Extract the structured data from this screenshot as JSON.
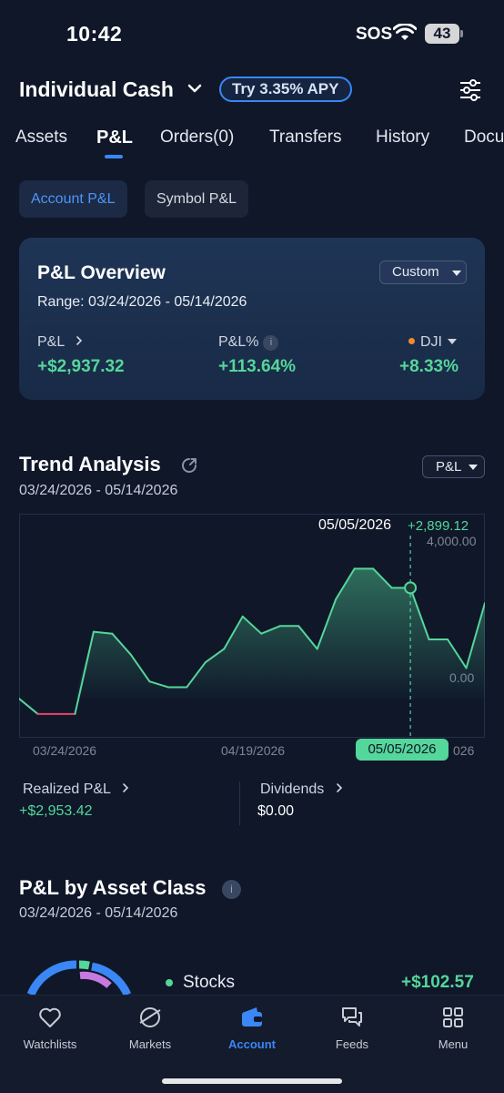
{
  "status_bar": {
    "time": "10:42",
    "sos": "SOS",
    "battery": "43"
  },
  "header": {
    "account_name": "Individual Cash",
    "apy_badge": "Try 3.35% APY"
  },
  "tabs": [
    "Assets",
    "P&L",
    "Orders(0)",
    "Transfers",
    "History",
    "Docu"
  ],
  "active_tab": "P&L",
  "segments": {
    "account": "Account P&L",
    "symbol": "Symbol P&L"
  },
  "overview": {
    "title": "P&L Overview",
    "range": "Range: 03/24/2026 - 05/14/2026",
    "custom_label": "Custom",
    "pl_label": "P&L",
    "pl_value": "+$2,937.32",
    "pl_pct_label": "P&L%",
    "pl_pct_value": "+113.64%",
    "bench_label": "DJI",
    "bench_value": "+8.33%"
  },
  "trend": {
    "title": "Trend Analysis",
    "range": "03/24/2026 - 05/14/2026",
    "select_label": "P&L",
    "tooltip_date": "05/05/2026",
    "tooltip_value": "+2,899.12",
    "pill_date": "05/05/2026",
    "realized_label": "Realized P&L",
    "realized_value": "+$2,953.42",
    "dividends_label": "Dividends",
    "dividends_value": "$0.00"
  },
  "chart_data": {
    "type": "area",
    "x_ticks": [
      "03/24/2026",
      "04/19/2026",
      "026"
    ],
    "y_ticks": [
      "4,000.00",
      "0.00"
    ],
    "ylim": [
      -1000,
      4600
    ],
    "grid": false,
    "highlight": {
      "date": "05/05/2026",
      "value": 2899.12
    },
    "x": [
      "03/24",
      "03/26",
      "03/28",
      "03/30",
      "04/01",
      "04/03",
      "04/05",
      "04/07",
      "04/09",
      "04/11",
      "04/13",
      "04/15",
      "04/17",
      "04/19",
      "04/21",
      "04/23",
      "04/25",
      "04/27",
      "04/29",
      "05/01",
      "05/03",
      "05/05",
      "05/07",
      "05/09",
      "05/11",
      "05/14"
    ],
    "values": [
      0,
      -400,
      -400,
      -400,
      1750,
      1700,
      1150,
      450,
      300,
      300,
      950,
      1300,
      2150,
      1700,
      1900,
      1900,
      1300,
      2600,
      3400,
      3400,
      2900,
      2899,
      1550,
      1550,
      800,
      2500
    ],
    "series": [
      {
        "values": [
          0,
          -400,
          -400,
          -400,
          1750,
          1700,
          1150,
          450,
          300,
          300,
          950,
          1300,
          2150,
          1700,
          1900,
          1900,
          1300,
          2600,
          3400,
          3400,
          2900,
          2899,
          1550,
          1550,
          800,
          2500
        ]
      }
    ],
    "colors": {
      "positive": "#55d69a",
      "negative": "#e8456a"
    }
  },
  "asset_class": {
    "title": "P&L by Asset Class",
    "range": "03/24/2026 - 05/14/2026",
    "stocks_label": "Stocks",
    "stocks_value": "+$102.57"
  },
  "nav": [
    {
      "label": "Watchlists",
      "icon": "heart-icon"
    },
    {
      "label": "Markets",
      "icon": "planet-icon"
    },
    {
      "label": "Account",
      "icon": "wallet-icon"
    },
    {
      "label": "Feeds",
      "icon": "chat-icon"
    },
    {
      "label": "Menu",
      "icon": "grid-icon"
    }
  ],
  "active_nav": "Account",
  "colors": {
    "accent": "#3a87f5",
    "gain": "#55d69a",
    "loss": "#e8456a",
    "background": "#0f1729"
  }
}
